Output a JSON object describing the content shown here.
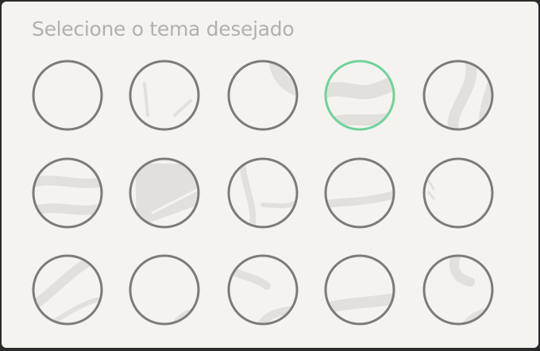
{
  "panel": {
    "title": "Selecione o tema desejado"
  },
  "colors": {
    "background": "#f4f3f0",
    "ring": "#7d7a77",
    "selected_ring": "#6fd39a",
    "pattern": "#e2e0dc",
    "title_text": "#b3b0ac"
  },
  "themes": [
    {
      "id": "theme-1",
      "selected": false
    },
    {
      "id": "theme-2",
      "selected": false
    },
    {
      "id": "theme-3",
      "selected": false
    },
    {
      "id": "theme-4",
      "selected": true
    },
    {
      "id": "theme-5",
      "selected": false
    },
    {
      "id": "theme-6",
      "selected": false
    },
    {
      "id": "theme-7",
      "selected": false
    },
    {
      "id": "theme-8",
      "selected": false
    },
    {
      "id": "theme-9",
      "selected": false
    },
    {
      "id": "theme-10",
      "selected": false
    },
    {
      "id": "theme-11",
      "selected": false
    },
    {
      "id": "theme-12",
      "selected": false
    },
    {
      "id": "theme-13",
      "selected": false
    },
    {
      "id": "theme-14",
      "selected": false
    },
    {
      "id": "theme-15",
      "selected": false
    }
  ]
}
